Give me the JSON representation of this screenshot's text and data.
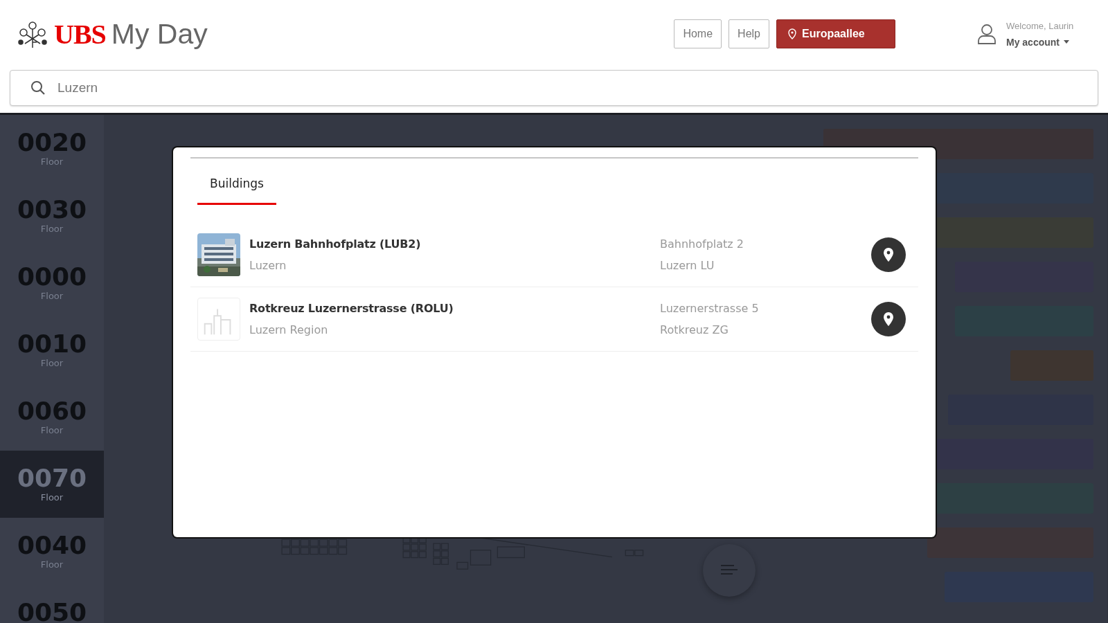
{
  "header": {
    "logo_mark": "UBS",
    "app_name": "My Day",
    "nav": [
      {
        "label": "Home",
        "kind": "outline"
      },
      {
        "label": "Help",
        "kind": "outline"
      },
      {
        "label": "Europaallee",
        "kind": "location"
      }
    ],
    "user": {
      "greeting": "Welcome, Laurin",
      "account_menu": "My account"
    }
  },
  "search": {
    "value": "Luzern"
  },
  "floors": [
    {
      "number": "0020",
      "label": "Floor",
      "selected": false
    },
    {
      "number": "0030",
      "label": "Floor",
      "selected": false
    },
    {
      "number": "0000",
      "label": "Floor",
      "selected": false
    },
    {
      "number": "0010",
      "label": "Floor",
      "selected": false
    },
    {
      "number": "0060",
      "label": "Floor",
      "selected": false
    },
    {
      "number": "0070",
      "label": "Floor",
      "selected": true
    },
    {
      "number": "0040",
      "label": "Floor",
      "selected": false
    },
    {
      "number": "0050",
      "selected": false
    }
  ],
  "legend": [
    {
      "color": "#3a3236"
    },
    {
      "color": "#2f3a4c"
    },
    {
      "color": "#3a3c36"
    },
    {
      "color": "#35344a"
    },
    {
      "color": "#2c4046"
    },
    {
      "color": "#3e3530"
    },
    {
      "color": "#2f3448"
    },
    {
      "color": "#33334a"
    },
    {
      "color": "#2d4044"
    },
    {
      "color": "#3d3438"
    },
    {
      "color": "#2e3850"
    }
  ],
  "modal": {
    "tabs": [
      {
        "label": "Buildings",
        "selected": true
      }
    ],
    "results": [
      {
        "name": "Luzern Bahnhofplatz (LUB2)",
        "region": "Luzern",
        "street": "Bahnhofplatz 2",
        "city": "Luzern LU",
        "photo": true
      },
      {
        "name": "Rotkreuz Luzernerstrasse (ROLU)",
        "region": "Luzern Region",
        "street": "Luzernerstrasse 5",
        "city": "Rotkreuz ZG",
        "photo": false
      }
    ]
  }
}
